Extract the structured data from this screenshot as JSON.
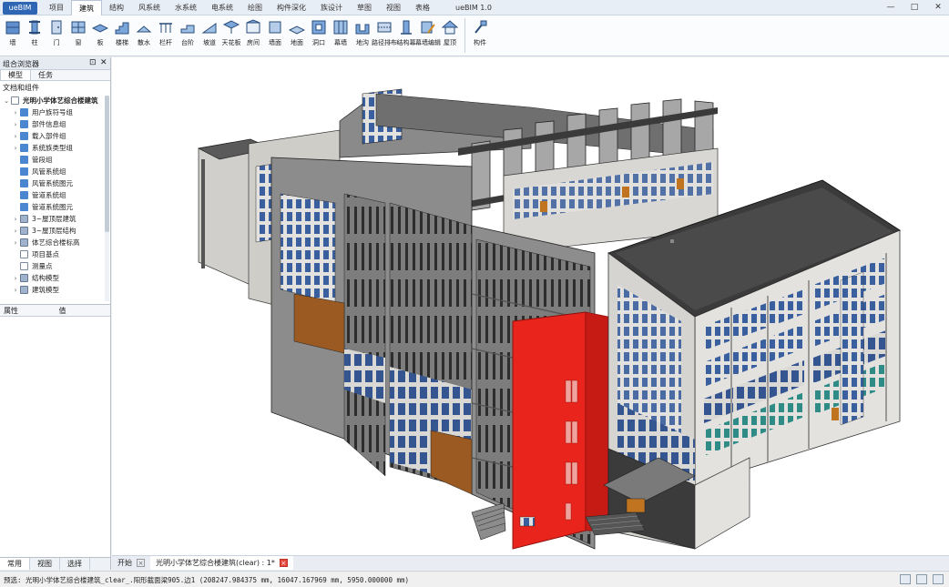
{
  "app": {
    "button_label": "ueBIM",
    "window_title": "ueBIM 1.0"
  },
  "ribbon_tabs": [
    {
      "label": "项目",
      "active": false
    },
    {
      "label": "建筑",
      "active": true
    },
    {
      "label": "结构",
      "active": false
    },
    {
      "label": "风系统",
      "active": false
    },
    {
      "label": "水系统",
      "active": false
    },
    {
      "label": "电系统",
      "active": false
    },
    {
      "label": "绘图",
      "active": false
    },
    {
      "label": "构件深化",
      "active": false
    },
    {
      "label": "族设计",
      "active": false
    },
    {
      "label": "草图",
      "active": false
    },
    {
      "label": "视图",
      "active": false
    },
    {
      "label": "表格",
      "active": false
    }
  ],
  "tools": [
    {
      "label": "墙",
      "icon": "wall-icon"
    },
    {
      "label": "柱",
      "icon": "column-icon"
    },
    {
      "label": "门",
      "icon": "door-icon"
    },
    {
      "label": "窗",
      "icon": "window-icon"
    },
    {
      "label": "板",
      "icon": "slab-icon"
    },
    {
      "label": "楼梯",
      "icon": "stair-icon"
    },
    {
      "label": "散水",
      "icon": "apron-icon"
    },
    {
      "label": "栏杆",
      "icon": "railing-icon"
    },
    {
      "label": "台阶",
      "icon": "step-icon"
    },
    {
      "label": "坡道",
      "icon": "ramp-icon"
    },
    {
      "label": "天花板",
      "icon": "ceiling-icon"
    },
    {
      "label": "房间",
      "icon": "room-icon"
    },
    {
      "label": "墙面",
      "icon": "wall-face-icon"
    },
    {
      "label": "地面",
      "icon": "floor-face-icon"
    },
    {
      "label": "洞口",
      "icon": "opening-icon"
    },
    {
      "label": "幕墙",
      "icon": "curtain-wall-icon"
    },
    {
      "label": "地沟",
      "icon": "trench-icon"
    },
    {
      "label": "路径排布",
      "icon": "path-layout-icon"
    },
    {
      "label": "结构幕",
      "icon": "structure-curtain-icon"
    },
    {
      "label": "幕墙编辑",
      "icon": "curtain-edit-icon"
    },
    {
      "label": "屋顶",
      "icon": "roof-icon"
    },
    {
      "label": "构件",
      "icon": "component-icon"
    }
  ],
  "left_panel": {
    "title": "组合浏览器",
    "subtabs": [
      "模型",
      "任务"
    ],
    "tree_header": "文档和组件",
    "root": "光明小学体艺综合楼建筑",
    "items": [
      {
        "label": "用户族符号组",
        "expandable": true,
        "icon": "blue"
      },
      {
        "label": "部件信息组",
        "expandable": true,
        "icon": "blue"
      },
      {
        "label": "载入部件组",
        "expandable": true,
        "icon": "blue"
      },
      {
        "label": "系统族类型组",
        "expandable": true,
        "icon": "blue"
      },
      {
        "label": "管段组",
        "expandable": false,
        "icon": "blue"
      },
      {
        "label": "风管系统组",
        "expandable": false,
        "icon": "blue"
      },
      {
        "label": "风管系统图元",
        "expandable": false,
        "icon": "blue"
      },
      {
        "label": "管道系统组",
        "expandable": false,
        "icon": "blue"
      },
      {
        "label": "管道系统图元",
        "expandable": false,
        "icon": "blue"
      },
      {
        "label": "3~屋顶层建筑",
        "expandable": true,
        "icon": "grid"
      },
      {
        "label": "3~屋顶层结构",
        "expandable": true,
        "icon": "grid"
      },
      {
        "label": "体艺综合楼标高",
        "expandable": true,
        "icon": "grid"
      },
      {
        "label": "项目基点",
        "expandable": false,
        "icon": "doc"
      },
      {
        "label": "测量点",
        "expandable": false,
        "icon": "doc"
      },
      {
        "label": "结构模型",
        "expandable": true,
        "icon": "grid"
      },
      {
        "label": "建筑模型",
        "expandable": true,
        "icon": "grid"
      }
    ],
    "props_columns": [
      "属性",
      "值"
    ],
    "bottom_tabs": [
      "常用",
      "视图",
      "选择"
    ]
  },
  "doc_tabs": [
    {
      "label": "开始",
      "close": "×",
      "active": false
    },
    {
      "label": "光明小学体艺综合楼建筑(clear) : 1*",
      "close": "×",
      "active": true
    }
  ],
  "status_text": "预选: 光明小学体艺综合楼建筑_clear_.阳形截面梁905.边1 (208247.984375 mm, 16047.167969 mm, 5950.000000 mm)",
  "colors": {
    "highlight": "#e8241c",
    "accent": "#2f66b3",
    "roof": "#3a3a3a",
    "wall": "#e3e2df",
    "glass": "#3a5f9e"
  }
}
